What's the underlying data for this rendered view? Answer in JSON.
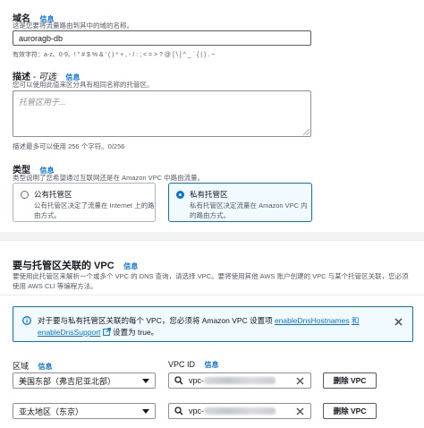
{
  "domain_section": {
    "label": "域名",
    "info": "信息",
    "description": "这是您要将流量路由到其中的域的名称。",
    "value": "auroragb-db",
    "valid_chars": "有效字符：a-z、0-9、! \" # $ % & ' ( ) * + , - / : ; < = > ? @ [ \\ ] ^ _ ` { | } . ~"
  },
  "description_section": {
    "label": "描述",
    "optional": "- 可选",
    "info": "信息",
    "description": "您可以使用此值来区分具有相同名称的托管区。",
    "placeholder": "托管区用于...",
    "limit_text": "描述最多可以使用 256 个字符。0/256"
  },
  "type_section": {
    "label": "类型",
    "info": "信息",
    "description": "类型说明了您希望通过互联网还是在 Amazon VPC 中路由流量。",
    "options": [
      {
        "title": "公有托管区",
        "desc": "公有托管区决定了流量在 Internet 上的路由方式。",
        "selected": false
      },
      {
        "title": "私有托管区",
        "desc": "私有托管区决定流量在 Amazon VPC 内的路由方式。",
        "selected": true
      }
    ]
  },
  "vpc_section": {
    "title": "要与托管区关联的 VPC",
    "info": "信息",
    "description": "要使用此托管区来解析一个或多个 VPC 的 DNS 查询，请选择 VPC。要将使用其他 AWS 账户创建的 VPC 与某个托管区关联，您必须使用 AWS CLI 等编程方法。",
    "alert": {
      "text_before": "对于要与私有托管区关联的每个 VPC，您必须将 Amazon VPC 设置项",
      "link1": "enableDnsHostnames",
      "and": "和",
      "link2": "enableDnsSupport",
      "text_after": "设置为 true。"
    },
    "region_label": "区域",
    "region_info": "信息",
    "vpcid_label": "VPC ID",
    "vpcid_info": "信息",
    "rows": [
      {
        "region": "美国东部（弗吉尼亚北部）",
        "vpc_prefix": "vpc-",
        "remove": "删除 VPC"
      },
      {
        "region": "亚太地区（东京）",
        "vpc_prefix": "vpc-",
        "remove": "删除 VPC"
      }
    ]
  },
  "colors": {
    "accent": "#0972d3",
    "alert_bg": "#f1faff",
    "band": "#f2f3f3"
  }
}
